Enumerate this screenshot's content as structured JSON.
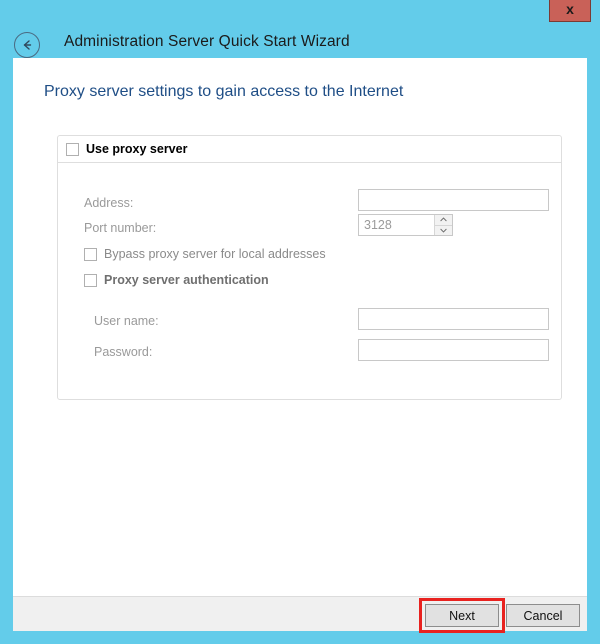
{
  "window": {
    "title": "Administration Server Quick Start Wizard",
    "close_label": "x",
    "back_icon": "back-arrow-icon",
    "accent_background": "#63ccea",
    "heading_color": "#1f4e86"
  },
  "page": {
    "heading": "Proxy server settings to gain access to the Internet"
  },
  "group": {
    "use_proxy_label": "Use proxy server",
    "use_proxy_checked": false,
    "fields": {
      "address_label": "Address:",
      "address_value": "",
      "port_label": "Port number:",
      "port_value": "3128",
      "spinner_up": "▲",
      "spinner_down": "▼"
    },
    "bypass_label": "Bypass proxy server for local addresses",
    "bypass_checked": false,
    "auth_label": "Proxy server authentication",
    "auth_checked": false,
    "credentials": {
      "username_label": "User name:",
      "username_value": "",
      "password_label": "Password:",
      "password_value": ""
    }
  },
  "footer": {
    "next_label": "Next",
    "cancel_label": "Cancel",
    "highlight_color": "#e8221f"
  }
}
